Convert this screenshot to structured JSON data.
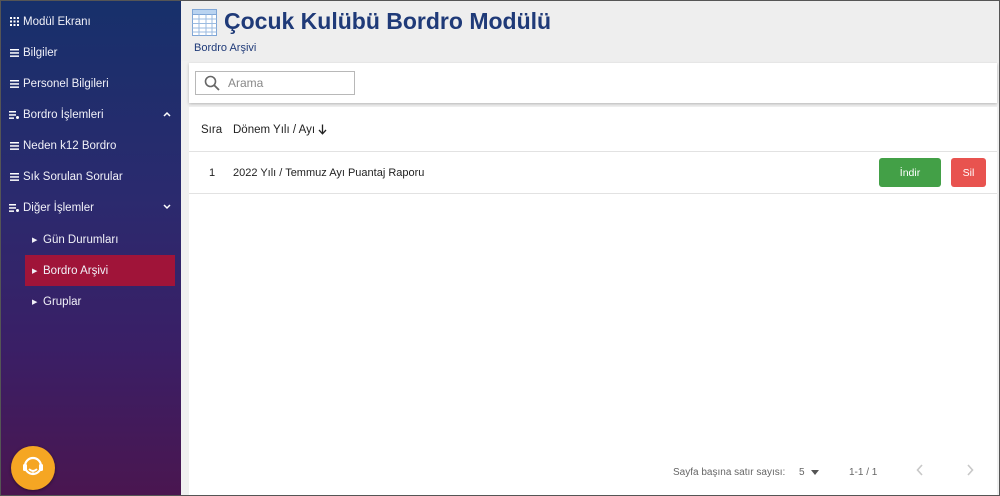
{
  "sidebar": {
    "items": [
      {
        "label": "Modül Ekranı",
        "icon": "grid-icon"
      },
      {
        "label": "Bilgiler",
        "icon": "list-icon"
      },
      {
        "label": "Personel Bilgileri",
        "icon": "list-icon"
      },
      {
        "label": "Bordro İşlemleri",
        "icon": "list-settings-icon",
        "chevron": "up"
      },
      {
        "label": "Neden k12 Bordro",
        "icon": "list-icon"
      },
      {
        "label": "Sık Sorulan Sorular",
        "icon": "list-icon"
      },
      {
        "label": "Diğer İşlemler",
        "icon": "list-settings-icon",
        "chevron": "down"
      }
    ],
    "sub_items": [
      {
        "label": "Gün Durumları",
        "active": false
      },
      {
        "label": "Bordro Arşivi",
        "active": true
      },
      {
        "label": "Gruplar",
        "active": false
      }
    ],
    "support_icon": "headset-support-icon",
    "active_color": "#a01439"
  },
  "header": {
    "title": "Çocuk Kulübü Bordro Modülü",
    "breadcrumb": "Bordro Arşivi"
  },
  "search": {
    "placeholder": "Arama"
  },
  "table": {
    "columns": {
      "index": "Sıra",
      "period": "Dönem Yılı / Ayı"
    },
    "sort_icon": "arrow-down-icon",
    "rows": [
      {
        "index": "1",
        "period": "2022 Yılı / Temmuz Ayı Puantaj Raporu",
        "download_label": "İndir",
        "delete_label": "Sil"
      }
    ]
  },
  "pagination": {
    "rows_per_page_label": "Sayfa başına satır sayısı:",
    "rows_per_page_value": "5",
    "range": "1-1 / 1"
  },
  "colors": {
    "title": "#1f3a78",
    "download": "#43a047",
    "delete": "#e8534f",
    "support": "#f5a623"
  }
}
